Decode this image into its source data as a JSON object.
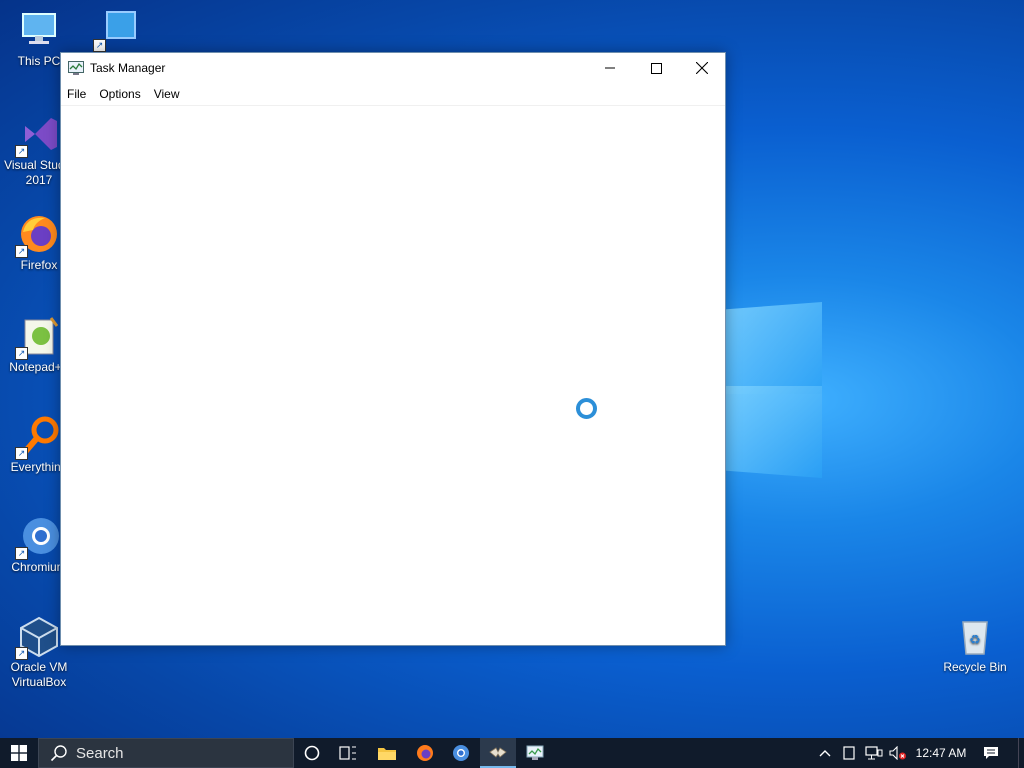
{
  "desktop": {
    "icons": [
      {
        "label": "This PC"
      },
      {
        "label": ""
      },
      {
        "label": "Visual Studio 2017"
      },
      {
        "label": "Firefox"
      },
      {
        "label": "Notepad++"
      },
      {
        "label": "Everything"
      },
      {
        "label": "Chromium"
      },
      {
        "label": "Oracle VM VirtualBox"
      },
      {
        "label": "Recycle Bin"
      }
    ]
  },
  "window": {
    "title": "Task Manager",
    "menu": [
      "File",
      "Options",
      "View"
    ],
    "loading": true
  },
  "taskbar": {
    "search_placeholder": "Search",
    "time": "12:47 AM",
    "accent": "#76b9ed"
  },
  "colors": {
    "desktop": "#0a5fd0",
    "taskbar": "#101b2b",
    "spinner": "#2c8fd8"
  }
}
